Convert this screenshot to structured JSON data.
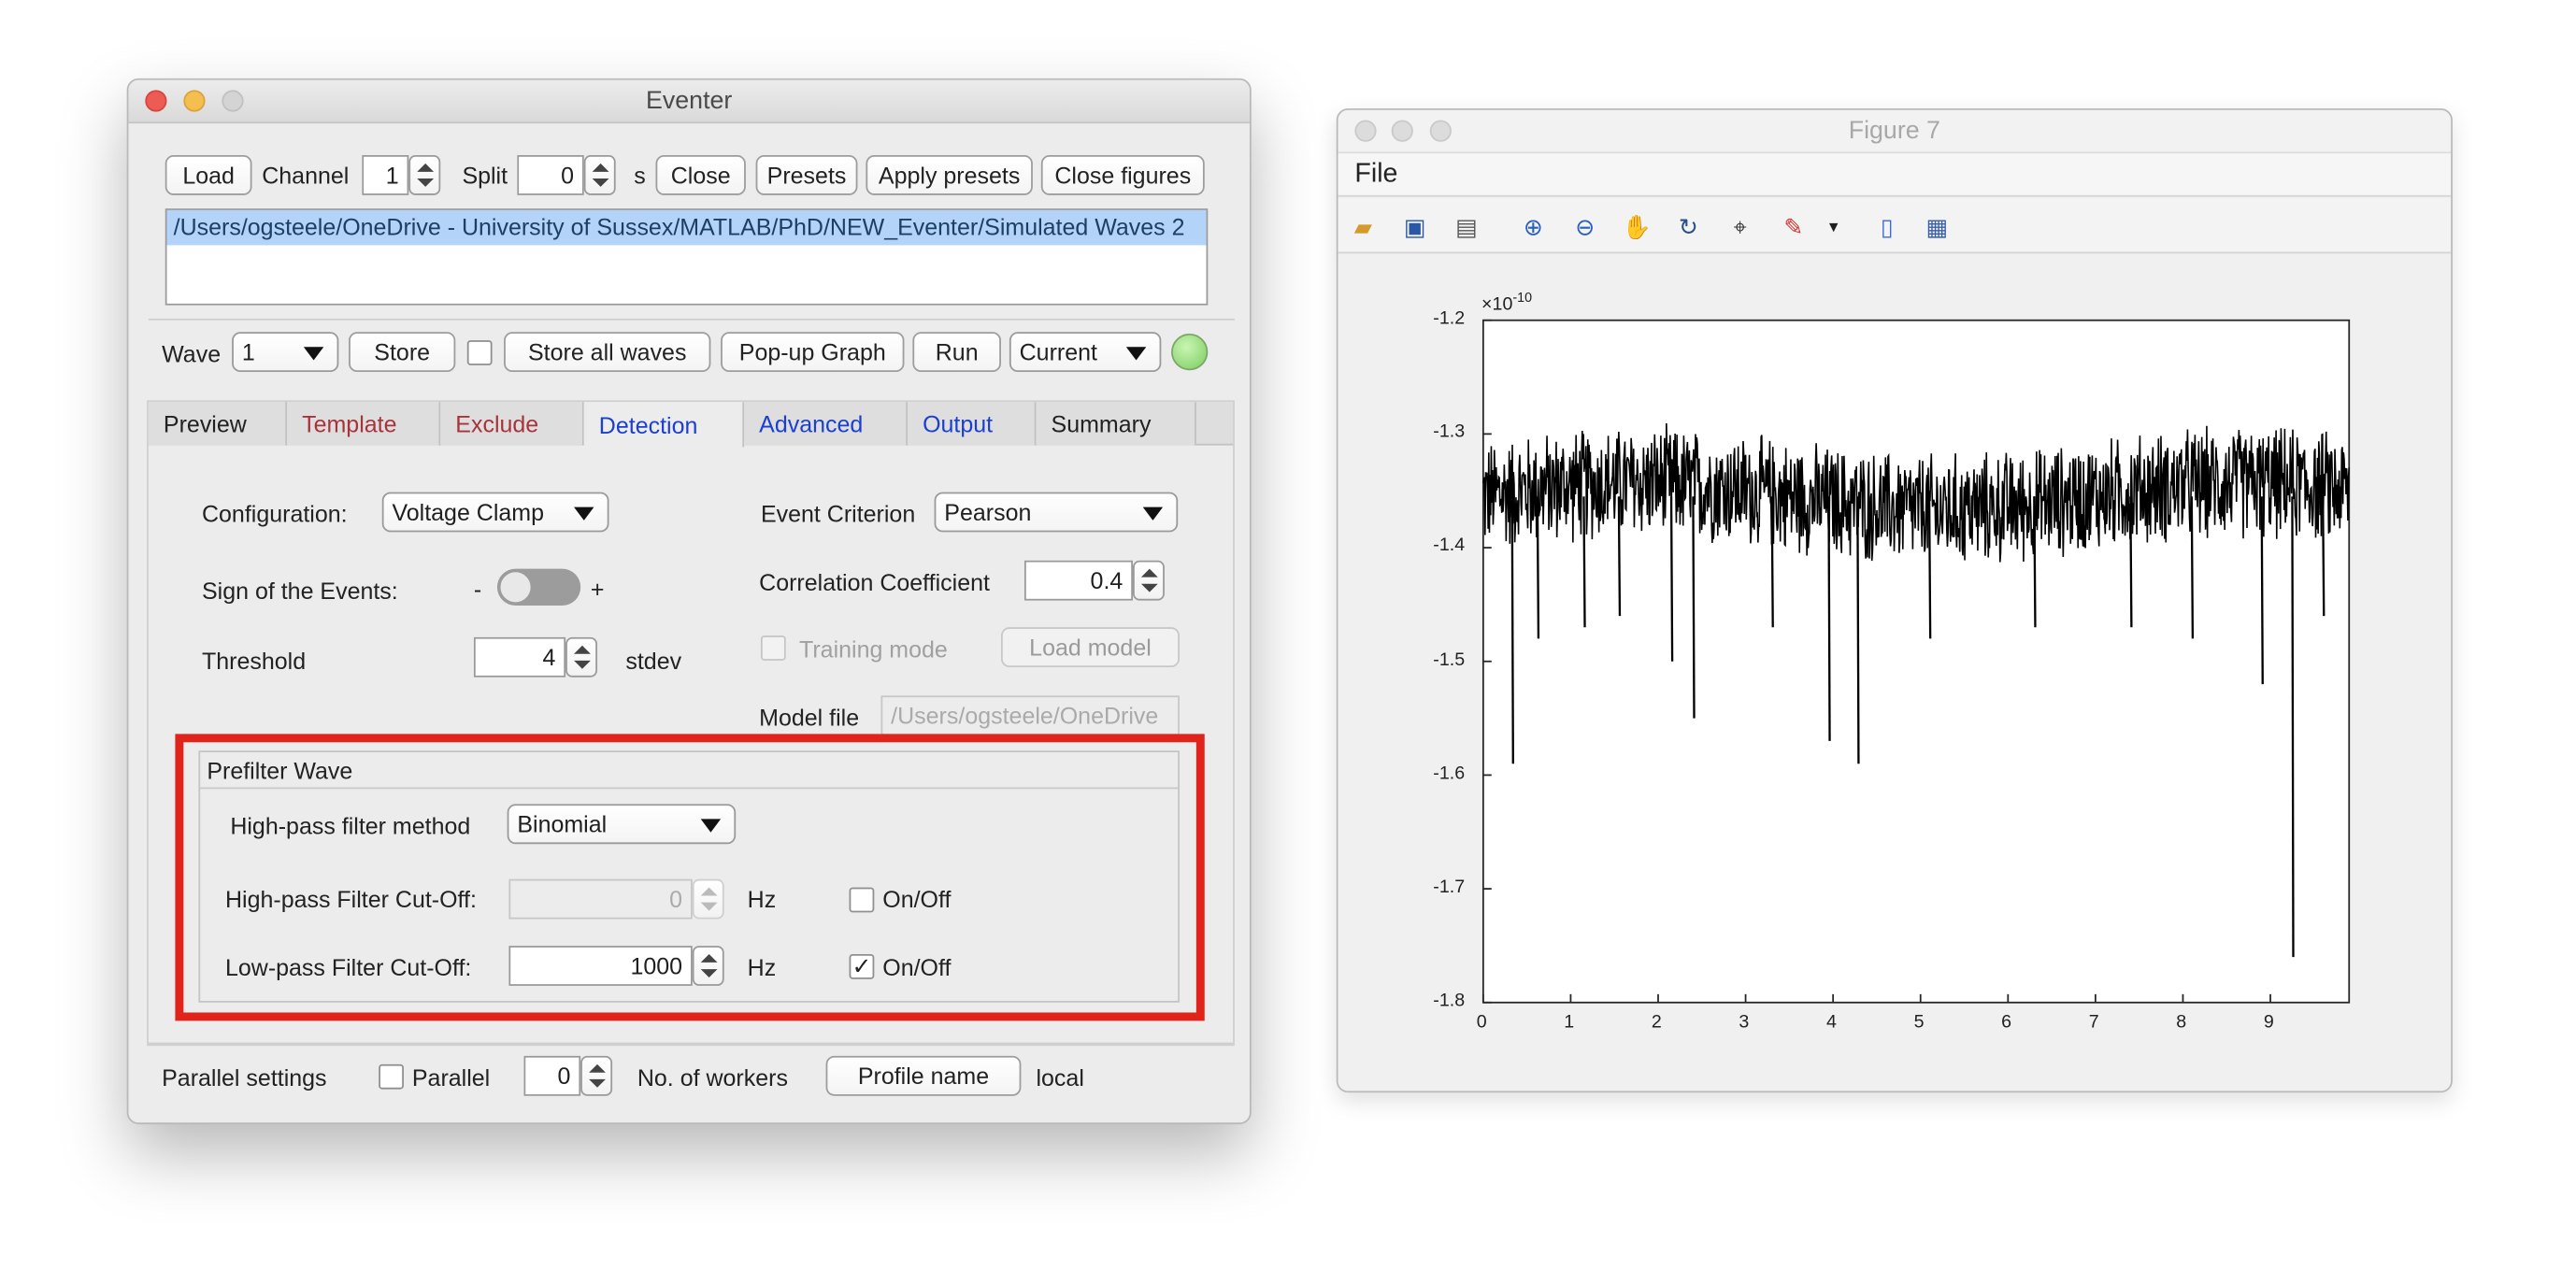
{
  "eventer": {
    "title": "Eventer",
    "toolbar": {
      "load": "Load",
      "channel_label": "Channel",
      "channel_value": "1",
      "split_label": "Split",
      "split_value": "0",
      "split_unit": "s",
      "close": "Close",
      "presets": "Presets",
      "apply_presets": "Apply presets",
      "close_figures": "Close figures"
    },
    "file_path": "/Users/ogsteele/OneDrive - University of Sussex/MATLAB/PhD/NEW_Eventer/Simulated Waves 2",
    "wavebar": {
      "wave_label": "Wave",
      "wave_value": "1",
      "store": "Store",
      "store_all": "Store all waves",
      "popup": "Pop-up Graph",
      "run": "Run",
      "mode": "Current"
    },
    "tabs": [
      {
        "label": "Preview",
        "color": "#222222"
      },
      {
        "label": "Template",
        "color": "#a8333a"
      },
      {
        "label": "Exclude",
        "color": "#a8333a"
      },
      {
        "label": "Detection",
        "color": "#1a3fd1"
      },
      {
        "label": "Advanced",
        "color": "#1a3fd1"
      },
      {
        "label": "Output",
        "color": "#1a3fd1"
      },
      {
        "label": "Summary",
        "color": "#222222"
      }
    ],
    "detection": {
      "configuration_label": "Configuration:",
      "configuration_value": "Voltage Clamp",
      "sign_label": "Sign of the Events:",
      "sign_minus": "-",
      "sign_plus": "+",
      "threshold_label": "Threshold",
      "threshold_value": "4",
      "threshold_unit": "stdev",
      "criterion_label": "Event Criterion",
      "criterion_value": "Pearson",
      "corr_label": "Correlation Coefficient",
      "corr_value": "0.4",
      "training_label": "Training mode",
      "load_model": "Load model",
      "model_file_label": "Model file",
      "model_file_value": "/Users/ogsteele/OneDrive"
    },
    "prefilter": {
      "title": "Prefilter Wave",
      "hp_method_label": "High-pass filter method",
      "hp_method_value": "Binomial",
      "hp_cutoff_label": "High-pass Filter Cut-Off:",
      "hp_cutoff_value": "0",
      "hp_unit": "Hz",
      "hp_onoff": "On/Off",
      "hp_checked": false,
      "lp_cutoff_label": "Low-pass Filter Cut-Off:",
      "lp_cutoff_value": "1000",
      "lp_unit": "Hz",
      "lp_onoff": "On/Off",
      "lp_checked": true,
      "check_mark": "✓"
    },
    "parallel": {
      "label": "Parallel settings",
      "parallel_label": "Parallel",
      "workers_value": "0",
      "workers_label": "No. of workers",
      "profile_button": "Profile name",
      "profile_value": "local"
    },
    "highlight_color": "#e0241b"
  },
  "figure": {
    "title": "Figure 7",
    "menu_file": "File",
    "tools": [
      "open-icon",
      "save-icon",
      "print-icon",
      "zoom-in-icon",
      "zoom-out-icon",
      "pan-icon",
      "rotate-icon",
      "data-cursor-icon",
      "brush-icon",
      "colorbar-icon",
      "legend-icon"
    ],
    "chart_data": {
      "type": "line",
      "title": "",
      "xlabel": "",
      "ylabel": "",
      "exponent_base": "×10",
      "exponent_power": "-10",
      "xlim": [
        0,
        9.9
      ],
      "ylim": [
        -1.8,
        -1.2
      ],
      "xticks": [
        "0",
        "1",
        "2",
        "3",
        "4",
        "5",
        "6",
        "7",
        "8",
        "9"
      ],
      "yticks": [
        "-1.2",
        "-1.3",
        "-1.4",
        "-1.5",
        "-1.6",
        "-1.7",
        "-1.8"
      ],
      "baseline": -1.355,
      "noise_band": [
        -1.41,
        -1.3
      ],
      "events": [
        {
          "x": 0.33,
          "y": -1.59
        },
        {
          "x": 0.62,
          "y": -1.48
        },
        {
          "x": 1.15,
          "y": -1.47
        },
        {
          "x": 1.55,
          "y": -1.46
        },
        {
          "x": 2.15,
          "y": -1.5
        },
        {
          "x": 2.4,
          "y": -1.55
        },
        {
          "x": 3.3,
          "y": -1.47
        },
        {
          "x": 3.95,
          "y": -1.57
        },
        {
          "x": 4.28,
          "y": -1.59
        },
        {
          "x": 5.1,
          "y": -1.48
        },
        {
          "x": 6.3,
          "y": -1.47
        },
        {
          "x": 7.4,
          "y": -1.47
        },
        {
          "x": 8.1,
          "y": -1.48
        },
        {
          "x": 8.9,
          "y": -1.52
        },
        {
          "x": 9.25,
          "y": -1.76
        },
        {
          "x": 9.6,
          "y": -1.46
        }
      ]
    }
  }
}
